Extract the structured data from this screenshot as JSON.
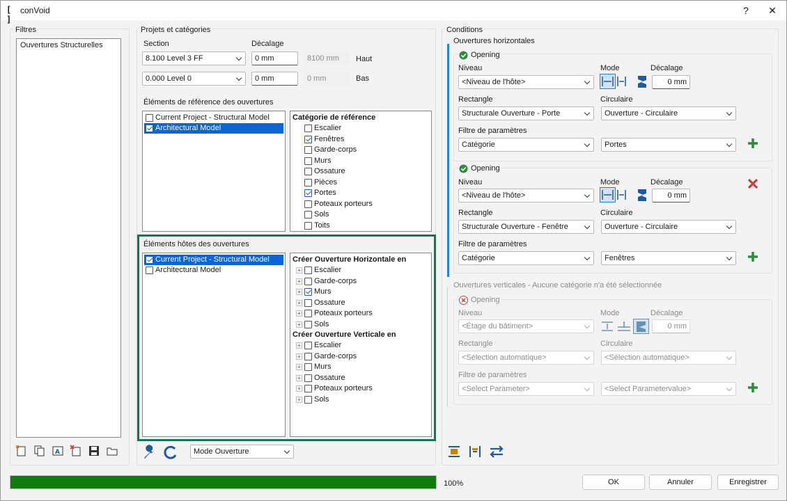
{
  "window": {
    "title": "conVoid",
    "help_label": "?",
    "close_label": "✕"
  },
  "filters": {
    "group_label": "Filtres",
    "items": [
      "Ouvertures Structurelles"
    ]
  },
  "projects": {
    "group_label": "Projets et catégories",
    "section_label": "Section",
    "offset_label": "Décalage",
    "top": {
      "level": "8.100  Level 3 FF",
      "offset": "0 mm",
      "computed": "8100 mm",
      "label": "Haut"
    },
    "bottom": {
      "level": "0.000  Level 0",
      "offset": "0 mm",
      "computed": "0 mm",
      "label": "Bas"
    },
    "reference_label": "Éléments de référence des ouvertures",
    "reference_models": [
      {
        "label": "Current Project - Structural Model",
        "checked": false,
        "selected": false
      },
      {
        "label": "Architectural Model",
        "checked": true,
        "selected": true
      }
    ],
    "reference_category_header": "Catégorie de référence",
    "reference_categories": [
      {
        "label": "Escalier",
        "checked": false
      },
      {
        "label": "Fenêtres",
        "checked": true
      },
      {
        "label": "Garde-corps",
        "checked": false
      },
      {
        "label": "Murs",
        "checked": false
      },
      {
        "label": "Ossature",
        "checked": false
      },
      {
        "label": "Pièces",
        "checked": false
      },
      {
        "label": "Portes",
        "checked": true
      },
      {
        "label": "Poteaux porteurs",
        "checked": false
      },
      {
        "label": "Sols",
        "checked": false
      },
      {
        "label": "Toits",
        "checked": false
      }
    ],
    "host_label": "Éléments hôtes des ouvertures",
    "host_models": [
      {
        "label": "Current Project - Structural Model",
        "checked": true,
        "selected": true
      },
      {
        "label": "Architectural Model",
        "checked": false,
        "selected": false
      }
    ],
    "host_horizontal_header": "Créer Ouverture Horizontale en",
    "host_horizontal": [
      {
        "label": "Escalier",
        "checked": false
      },
      {
        "label": "Garde-corps",
        "checked": false
      },
      {
        "label": "Murs",
        "checked": true
      },
      {
        "label": "Ossature",
        "checked": false
      },
      {
        "label": "Poteaux porteurs",
        "checked": false
      },
      {
        "label": "Sols",
        "checked": false
      }
    ],
    "host_vertical_header": "Créer Ouverture Verticale en",
    "host_vertical": [
      {
        "label": "Escalier",
        "checked": false
      },
      {
        "label": "Garde-corps",
        "checked": false
      },
      {
        "label": "Murs",
        "checked": false
      },
      {
        "label": "Ossature",
        "checked": false
      },
      {
        "label": "Poteaux porteurs",
        "checked": false
      },
      {
        "label": "Sols",
        "checked": false
      }
    ],
    "mode_select": "Mode Ouverture"
  },
  "conditions": {
    "group_label": "Conditions",
    "horizontal_label": "Ouvertures horizontales",
    "vertical_label": "Ouvertures verticales - Aucune catégorie n'a été sélectionnée",
    "niveau_label": "Niveau",
    "mode_label": "Mode",
    "offset_label": "Décalage",
    "rectangle_label": "Rectangle",
    "circulaire_label": "Circulaire",
    "filter_label": "Filtre de paramètres",
    "opening1": {
      "title": "Opening",
      "niveau": "<Niveau de l'hôte>",
      "offset": "0 mm",
      "rectangle": "Structurale Ouverture - Porte",
      "circulaire": "Ouverture - Circulaire",
      "param": "Catégorie",
      "value": "Portes"
    },
    "opening2": {
      "title": "Opening",
      "niveau": "<Niveau de l'hôte>",
      "offset": "0 mm",
      "rectangle": "Structurale Ouverture - Fenêtre",
      "circulaire": "Ouverture - Circulaire",
      "param": "Catégorie",
      "value": "Fenêtres"
    },
    "opening3": {
      "title": "Opening",
      "niveau": "<Étage du bâtiment>",
      "offset": "0 mm",
      "rectangle": "<Sélection automatique>",
      "circulaire": "<Sélection automatique>",
      "param": "<Select Parameter>",
      "value": "<Select Parametervalue>"
    }
  },
  "footer": {
    "progress": 100,
    "progress_label": "100%",
    "ok": "OK",
    "cancel": "Annuler",
    "save": "Enregistrer"
  },
  "colors": {
    "accent": "#0a64d2",
    "highlight_border": "#0b7a5a",
    "progress": "#0e7d0e",
    "add_green": "#2e8b3e",
    "delete_red": "#d23b3b",
    "condition_bar": "#2b7fd4"
  }
}
